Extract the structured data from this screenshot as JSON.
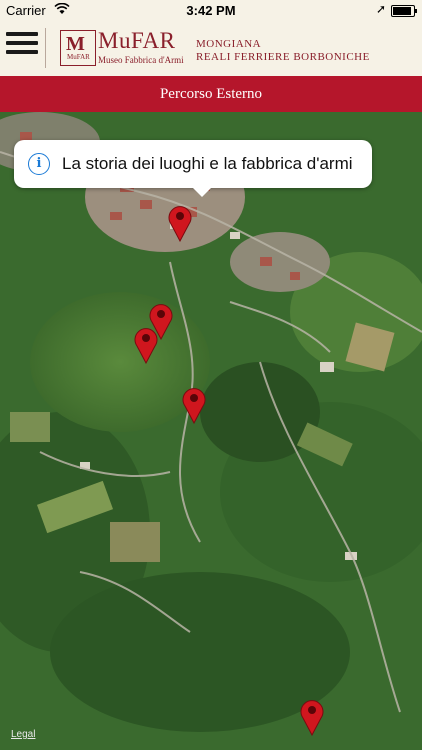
{
  "status_bar": {
    "carrier": "Carrier",
    "time": "3:42 PM",
    "battery_level": 0.95
  },
  "header": {
    "logo_name": "MuFAR",
    "logo_subtitle": "Museo Fabbrica d'Armi",
    "logo_mark": "MuFAR",
    "brand_line1": "MONGIANA",
    "brand_line2": "REALI FERRIERE BORBONICHE"
  },
  "title_bar": {
    "title": "Percorso Esterno"
  },
  "map": {
    "callout_text": "La storia dei luoghi e la fabbrica d'armi",
    "legal_label": "Legal",
    "pin_color": "#d0161e",
    "pin_count": 5
  },
  "colors": {
    "header_bg": "#f6f2e6",
    "brand_red": "#b5162b",
    "logo_red": "#8a1f2b"
  }
}
